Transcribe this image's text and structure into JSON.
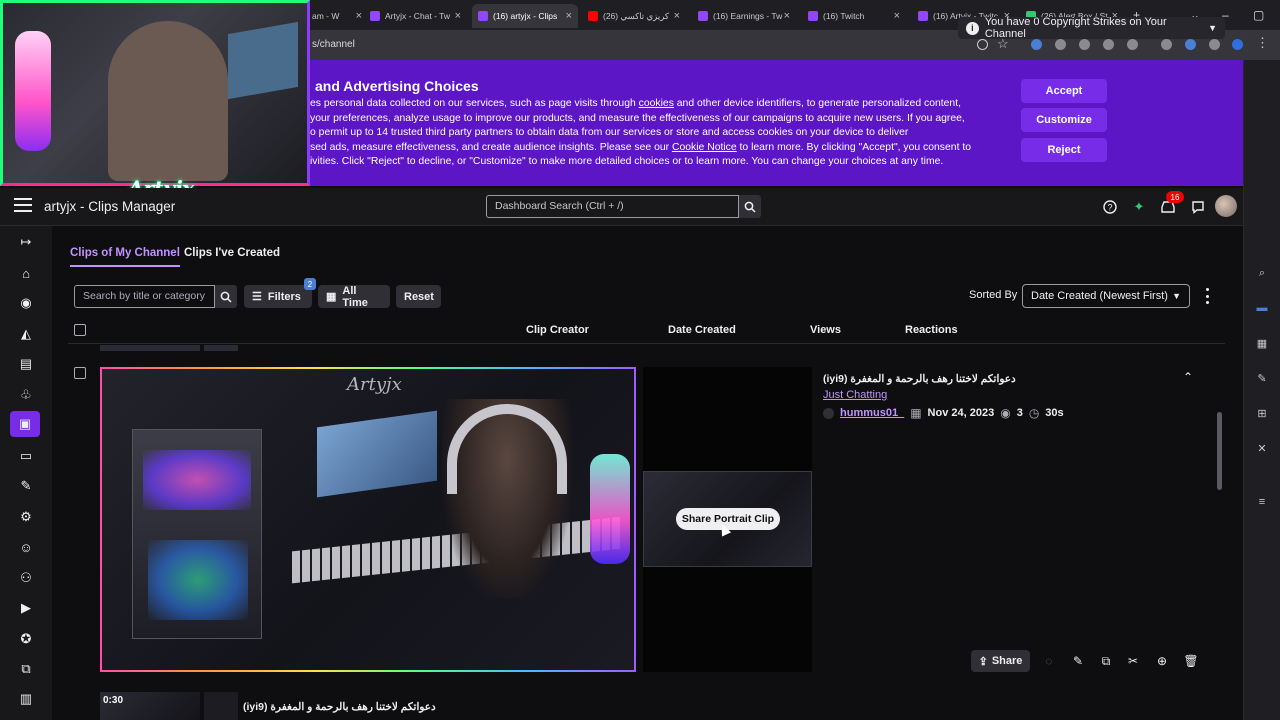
{
  "browser": {
    "tabs": [
      {
        "label": "am - W",
        "favicon": "twitch",
        "active": false
      },
      {
        "label": "Artyjx - Chat - Tw",
        "favicon": "twitch",
        "active": false
      },
      {
        "label": "(16) artyjx - Clips",
        "favicon": "twitch",
        "active": true
      },
      {
        "label": "(26) كريزي تاكسي",
        "favicon": "youtube",
        "active": false
      },
      {
        "label": "(16) Earnings - Tw",
        "favicon": "twitch",
        "active": false
      },
      {
        "label": "(16) Twitch",
        "favicon": "twitch",
        "active": false
      },
      {
        "label": "(16) Artyjx - Twitc",
        "favicon": "twitch",
        "active": false
      },
      {
        "label": "(26) Alert Box / St",
        "favicon": "streamlabs",
        "active": false
      }
    ],
    "new_tab": "+",
    "url": "s/channel"
  },
  "webcam": {
    "overlay_text": "Artyjx"
  },
  "cookie_banner": {
    "title": "and Advertising Choices",
    "lines": [
      {
        "before": "es personal data collected on our services, such as page visits through ",
        "link": "cookies",
        "after": " and other device identifiers, to generate personalized content,"
      },
      {
        "before": "your preferences, analyze usage to improve our products, and measure the effectiveness of our campaigns to acquire new users. If you agree,",
        "link": "",
        "after": ""
      },
      {
        "before": "o permit up to 14 trusted third party partners to obtain data from our services or store and access cookies on your device to deliver",
        "link": "",
        "after": ""
      },
      {
        "before": "sed ads, measure effectiveness, and create audience insights. Please see our ",
        "link": "Cookie Notice",
        "after": " to learn more. By clicking \"Accept\", you consent to"
      },
      {
        "before": "ivities. Click \"Reject\" to decline, or \"Customize\" to make more detailed choices or to learn more. You can change your choices at any time.",
        "link": "",
        "after": ""
      }
    ],
    "accept": "Accept",
    "customize": "Customize",
    "reject": "Reject"
  },
  "header": {
    "title": "artyjx - Clips Manager",
    "search_placeholder": "Dashboard Search (Ctrl + /)",
    "notification_count": "16"
  },
  "tabs": {
    "mine": "Clips of My Channel",
    "created": "Clips I've Created"
  },
  "copyright": "You have 0 Copyright Strikes on Your Channel",
  "filters": {
    "search_placeholder": "Search by title or category",
    "filters_label": "Filters",
    "filters_count": "2",
    "all_time": "All Time",
    "reset": "Reset",
    "sorted_by_label": "Sorted By",
    "sort_value": "Date Created (Newest First)"
  },
  "table": {
    "columns": [
      "Clip Creator",
      "Date Created",
      "Views",
      "Reactions"
    ]
  },
  "clip": {
    "watermark": "Artyjx",
    "share_portrait": "Share Portrait Clip",
    "title": "دعواتكم لاختنا رهف بالرحمة و المغفرة (iyi9)",
    "category": "Just Chatting",
    "creator": "hummus01_",
    "date": "Nov 24, 2023",
    "views": "3",
    "duration": "30s",
    "share": "Share"
  },
  "next_clip": {
    "duration": "0:30",
    "title": "دعواتكم لاختنا رهف بالرحمة و المغفرة (iyi9)"
  },
  "colors": {
    "brand": "#9147ff",
    "banner": "#5c16c5",
    "accent_link": "#bf94ff"
  }
}
